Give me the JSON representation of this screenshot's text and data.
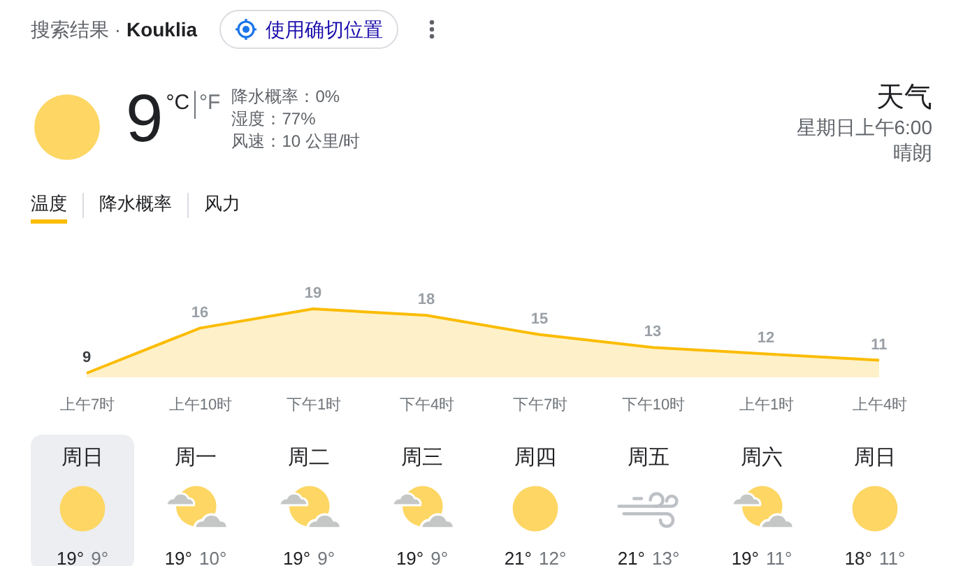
{
  "header": {
    "prefix": "搜索结果 · ",
    "location": "Kouklia",
    "location_button": "使用确切位置"
  },
  "current": {
    "kind": "sunny",
    "temperature": "9",
    "units": [
      {
        "label": "°C",
        "selected": true
      },
      {
        "label": "°F",
        "selected": false
      }
    ],
    "details": [
      "降水概率：0%",
      "湿度：77%",
      "风速：10 公里/时"
    ],
    "title": "天气",
    "time": "星期日上午6:00",
    "condition": "晴朗"
  },
  "tabs": [
    {
      "label": "温度",
      "selected": true
    },
    {
      "label": "降水概率",
      "selected": false
    },
    {
      "label": "风力",
      "selected": false
    }
  ],
  "chart_data": {
    "type": "area",
    "categories": [
      "上午7时",
      "上午10时",
      "下午1时",
      "下午4时",
      "下午7时",
      "下午10时",
      "上午1时",
      "上午4时"
    ],
    "values": [
      9,
      16,
      19,
      18,
      15,
      13,
      12,
      11
    ],
    "data_labels": true
  },
  "days": [
    {
      "day": "周日",
      "kind": "sunny",
      "high": "19°",
      "low": "9°",
      "selected": true
    },
    {
      "day": "周一",
      "kind": "partly_cloudy",
      "high": "19°",
      "low": "10°",
      "selected": false
    },
    {
      "day": "周二",
      "kind": "partly_cloudy",
      "high": "19°",
      "low": "9°",
      "selected": false
    },
    {
      "day": "周三",
      "kind": "partly_cloudy",
      "high": "19°",
      "low": "9°",
      "selected": false
    },
    {
      "day": "周四",
      "kind": "sunny",
      "high": "21°",
      "low": "12°",
      "selected": false
    },
    {
      "day": "周五",
      "kind": "windy",
      "high": "21°",
      "low": "13°",
      "selected": false
    },
    {
      "day": "周六",
      "kind": "partly_cloudy",
      "high": "19°",
      "low": "11°",
      "selected": false
    },
    {
      "day": "周日",
      "kind": "sunny",
      "high": "18°",
      "low": "11°",
      "selected": false
    }
  ]
}
